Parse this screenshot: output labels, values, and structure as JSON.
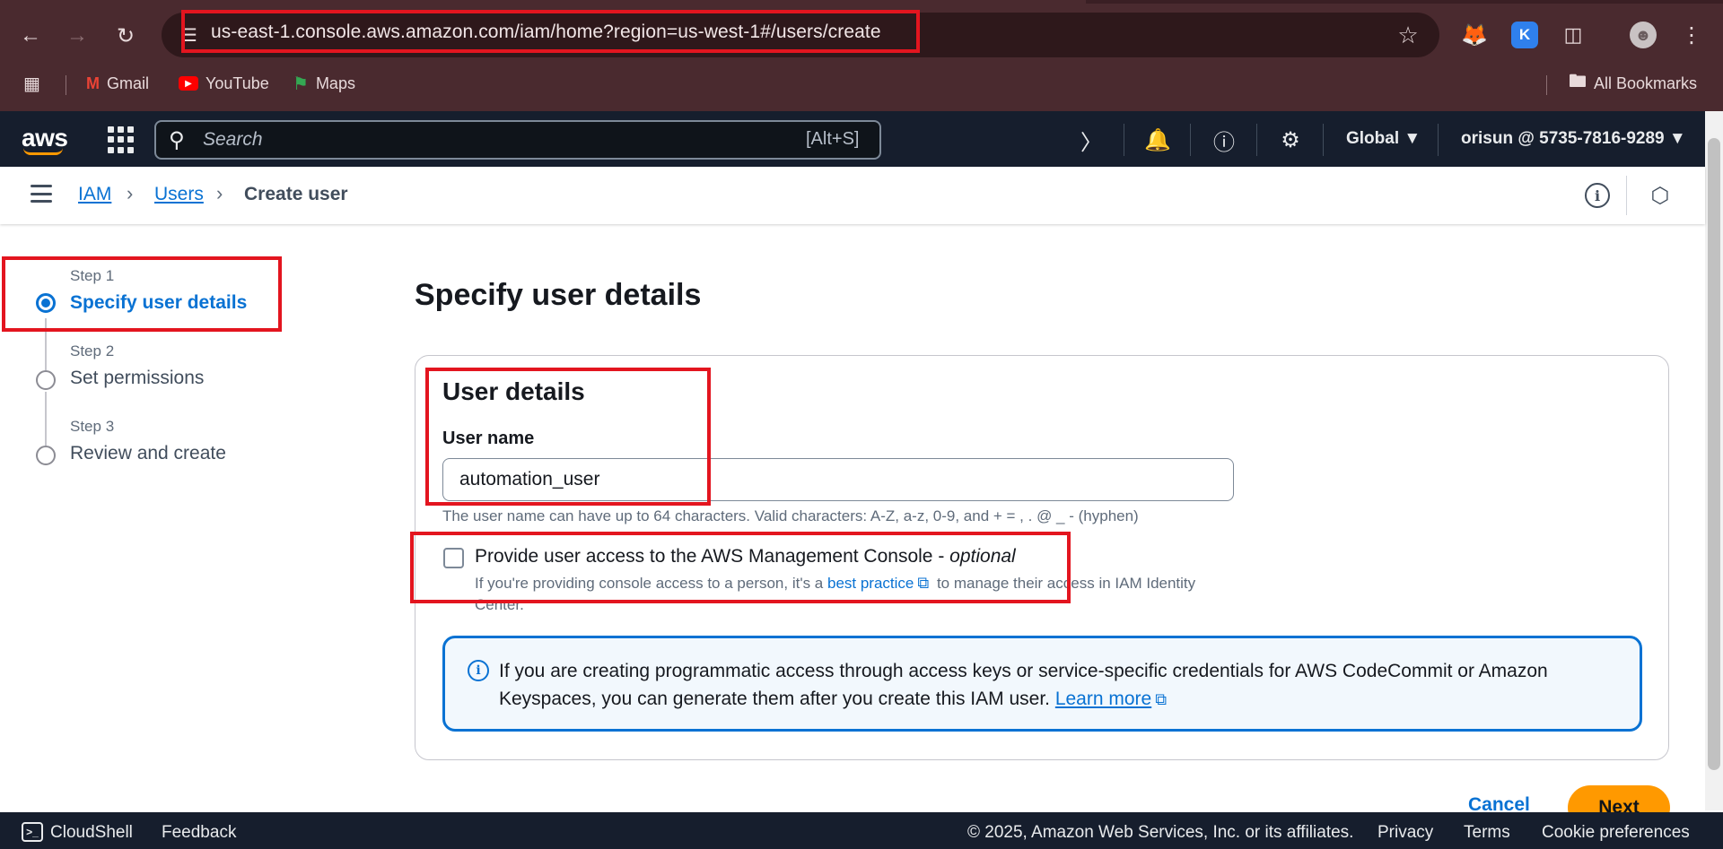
{
  "browser": {
    "url": "us-east-1.console.aws.amazon.com/iam/home?region=us-west-1#/users/create",
    "bookmarks": [
      {
        "label": "Gmail"
      },
      {
        "label": "YouTube"
      },
      {
        "label": "Maps"
      }
    ],
    "all_bookmarks": "All Bookmarks"
  },
  "aws_header": {
    "logo": "aws",
    "search_placeholder": "Search",
    "search_shortcut": "[Alt+S]",
    "region": "Global",
    "account": "orisun @ 5735-7816-9289"
  },
  "breadcrumb": {
    "items": [
      "IAM",
      "Users"
    ],
    "current": "Create user"
  },
  "steps": [
    {
      "step": "Step 1",
      "title": "Specify user details",
      "active": true
    },
    {
      "step": "Step 2",
      "title": "Set permissions",
      "active": false
    },
    {
      "step": "Step 3",
      "title": "Review and create",
      "active": false
    }
  ],
  "main": {
    "page_title": "Specify user details",
    "panel_title": "User details",
    "user_name_label": "User name",
    "user_name_value": "automation_user",
    "user_name_hint": "The user name can have up to 64 characters. Valid characters: A-Z, a-z, 0-9, and + = , . @ _ - (hyphen)",
    "console_access_label": "Provide user access to the AWS Management Console - ",
    "console_access_optional": "optional",
    "console_access_desc_before": "If you're providing console access to a person, it's a ",
    "console_access_desc_link": "best practice",
    "console_access_desc_after": " to manage their access in IAM Identity Center.",
    "info_text": "If you are creating programmatic access through access keys or service-specific credentials for AWS CodeCommit or Amazon Keyspaces, you can generate them after you create this IAM user. ",
    "info_link": "Learn more",
    "cancel_label": "Cancel",
    "next_label": "Next"
  },
  "footer": {
    "cloudshell": "CloudShell",
    "feedback": "Feedback",
    "copyright": "© 2025, Amazon Web Services, Inc. or its affiliates.",
    "privacy": "Privacy",
    "terms": "Terms",
    "cookie": "Cookie preferences"
  },
  "colors": {
    "accent": "#0972d3",
    "primary_button": "#ff9900",
    "header_bg": "#161e2d",
    "annotation": "#e3151f"
  }
}
